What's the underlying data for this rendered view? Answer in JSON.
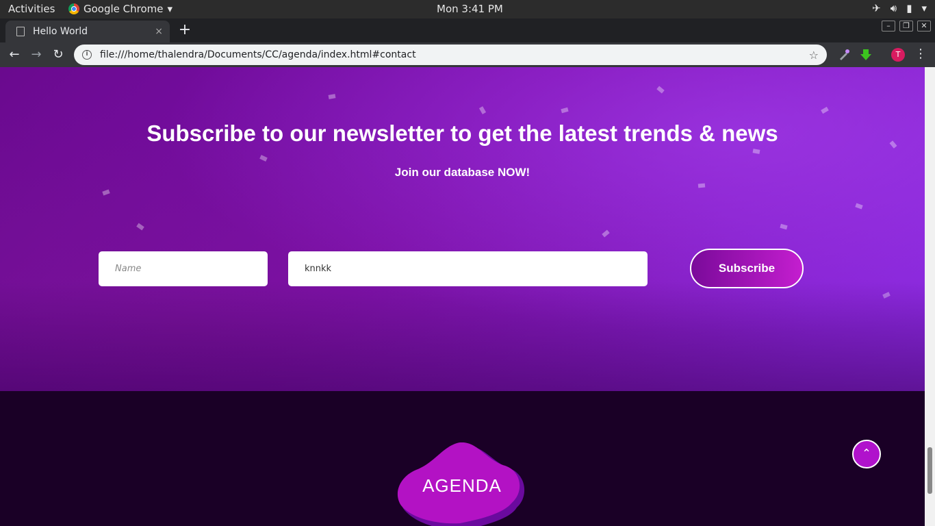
{
  "system_bar": {
    "activities": "Activities",
    "app_name": "Google Chrome",
    "app_menu_arrow": "▾",
    "clock": "Mon  3:41 PM",
    "icons": [
      "airplane-icon",
      "volume-icon",
      "battery-icon",
      "system-menu-icon"
    ]
  },
  "browser": {
    "tab_title": "Hello World",
    "tab_close": "×",
    "new_tab": "+",
    "url": "file:///home/thalendra/Documents/CC/agenda/index.html#contact",
    "info_glyph": "i",
    "star_glyph": "☆",
    "profile_initial": "T",
    "window_controls": [
      "–",
      "❐",
      "✕"
    ],
    "nav": {
      "back": "←",
      "forward": "→",
      "reload": "↻"
    },
    "menu": "⋮"
  },
  "newsletter": {
    "heading": "Subscribe to our newsletter to get the latest trends & news",
    "subheading": "Join our database NOW!",
    "name_placeholder": "Name",
    "email_value": "knnkk",
    "subscribe_label": "Subscribe"
  },
  "footer": {
    "logo_text": "AGENDA",
    "back_to_top": "⌃"
  },
  "colors": {
    "hero_purple": "#7d0fb0",
    "footer_bg": "#1a0026",
    "accent": "#b012cc"
  }
}
